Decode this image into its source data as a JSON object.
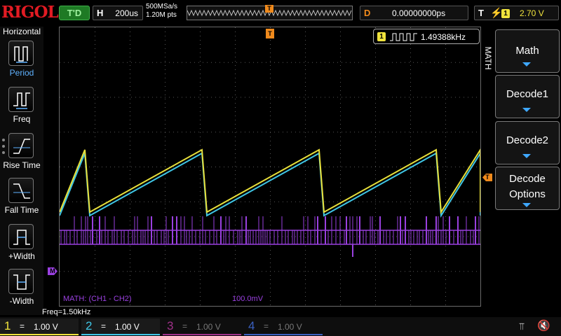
{
  "brand": "RIGOL",
  "top": {
    "run_state": "T'D",
    "horizontal": {
      "label": "H",
      "value": "200us"
    },
    "sample_rate": "500MSa/s",
    "memory_points": "1.20M pts",
    "trigger_position_marker": "T",
    "delay": {
      "label": "D",
      "value": "0.00000000ps"
    },
    "trigger": {
      "label": "T",
      "icon": "rising-edge-icon",
      "source": "1",
      "level": "2.70 V"
    }
  },
  "sidebar": {
    "title": "Horizontal",
    "items": [
      {
        "label": "Period",
        "icon": "period-icon"
      },
      {
        "label": "Freq",
        "icon": "freq-icon"
      },
      {
        "label": "Rise Time",
        "icon": "rise-time-icon"
      },
      {
        "label": "Fall Time",
        "icon": "fall-time-icon"
      },
      {
        "label": "+Width",
        "icon": "pos-width-icon"
      },
      {
        "label": "-Width",
        "icon": "neg-width-icon"
      }
    ]
  },
  "screen": {
    "frequency_counter": {
      "channel": "1",
      "value": "1.49388kHz"
    },
    "math_label": "MATH: (CH1 - CH2)",
    "math_scale": "100.0mV",
    "trigger_marker": "T",
    "level_marker": "T",
    "math_marker": "M",
    "waveforms": {
      "ch1_color": "#e8e03a",
      "ch2_color": "#3fc6e6",
      "math_color": "#9a40e0"
    }
  },
  "right_menu": {
    "tab": "MATH",
    "buttons": [
      {
        "label": "Math"
      },
      {
        "label": "Decode1"
      },
      {
        "label": "Decode2"
      },
      {
        "label": "Decode",
        "label2": "Options"
      }
    ]
  },
  "measurement_line": "Freq=1.50kHz",
  "channels": [
    {
      "num": "1",
      "coupling": "=",
      "scale": "1.00 V",
      "color": "#f0e33c",
      "active": true
    },
    {
      "num": "2",
      "coupling": "=",
      "scale": "1.00 V",
      "color": "#3fc6e6",
      "active": true
    },
    {
      "num": "3",
      "coupling": "=",
      "scale": "1.00 V",
      "color": "#a0308a",
      "active": false
    },
    {
      "num": "4",
      "coupling": "=",
      "scale": "1.00 V",
      "color": "#3a60c0",
      "active": false
    }
  ],
  "status_icons": [
    "usb-icon",
    "speaker-mute-icon"
  ]
}
